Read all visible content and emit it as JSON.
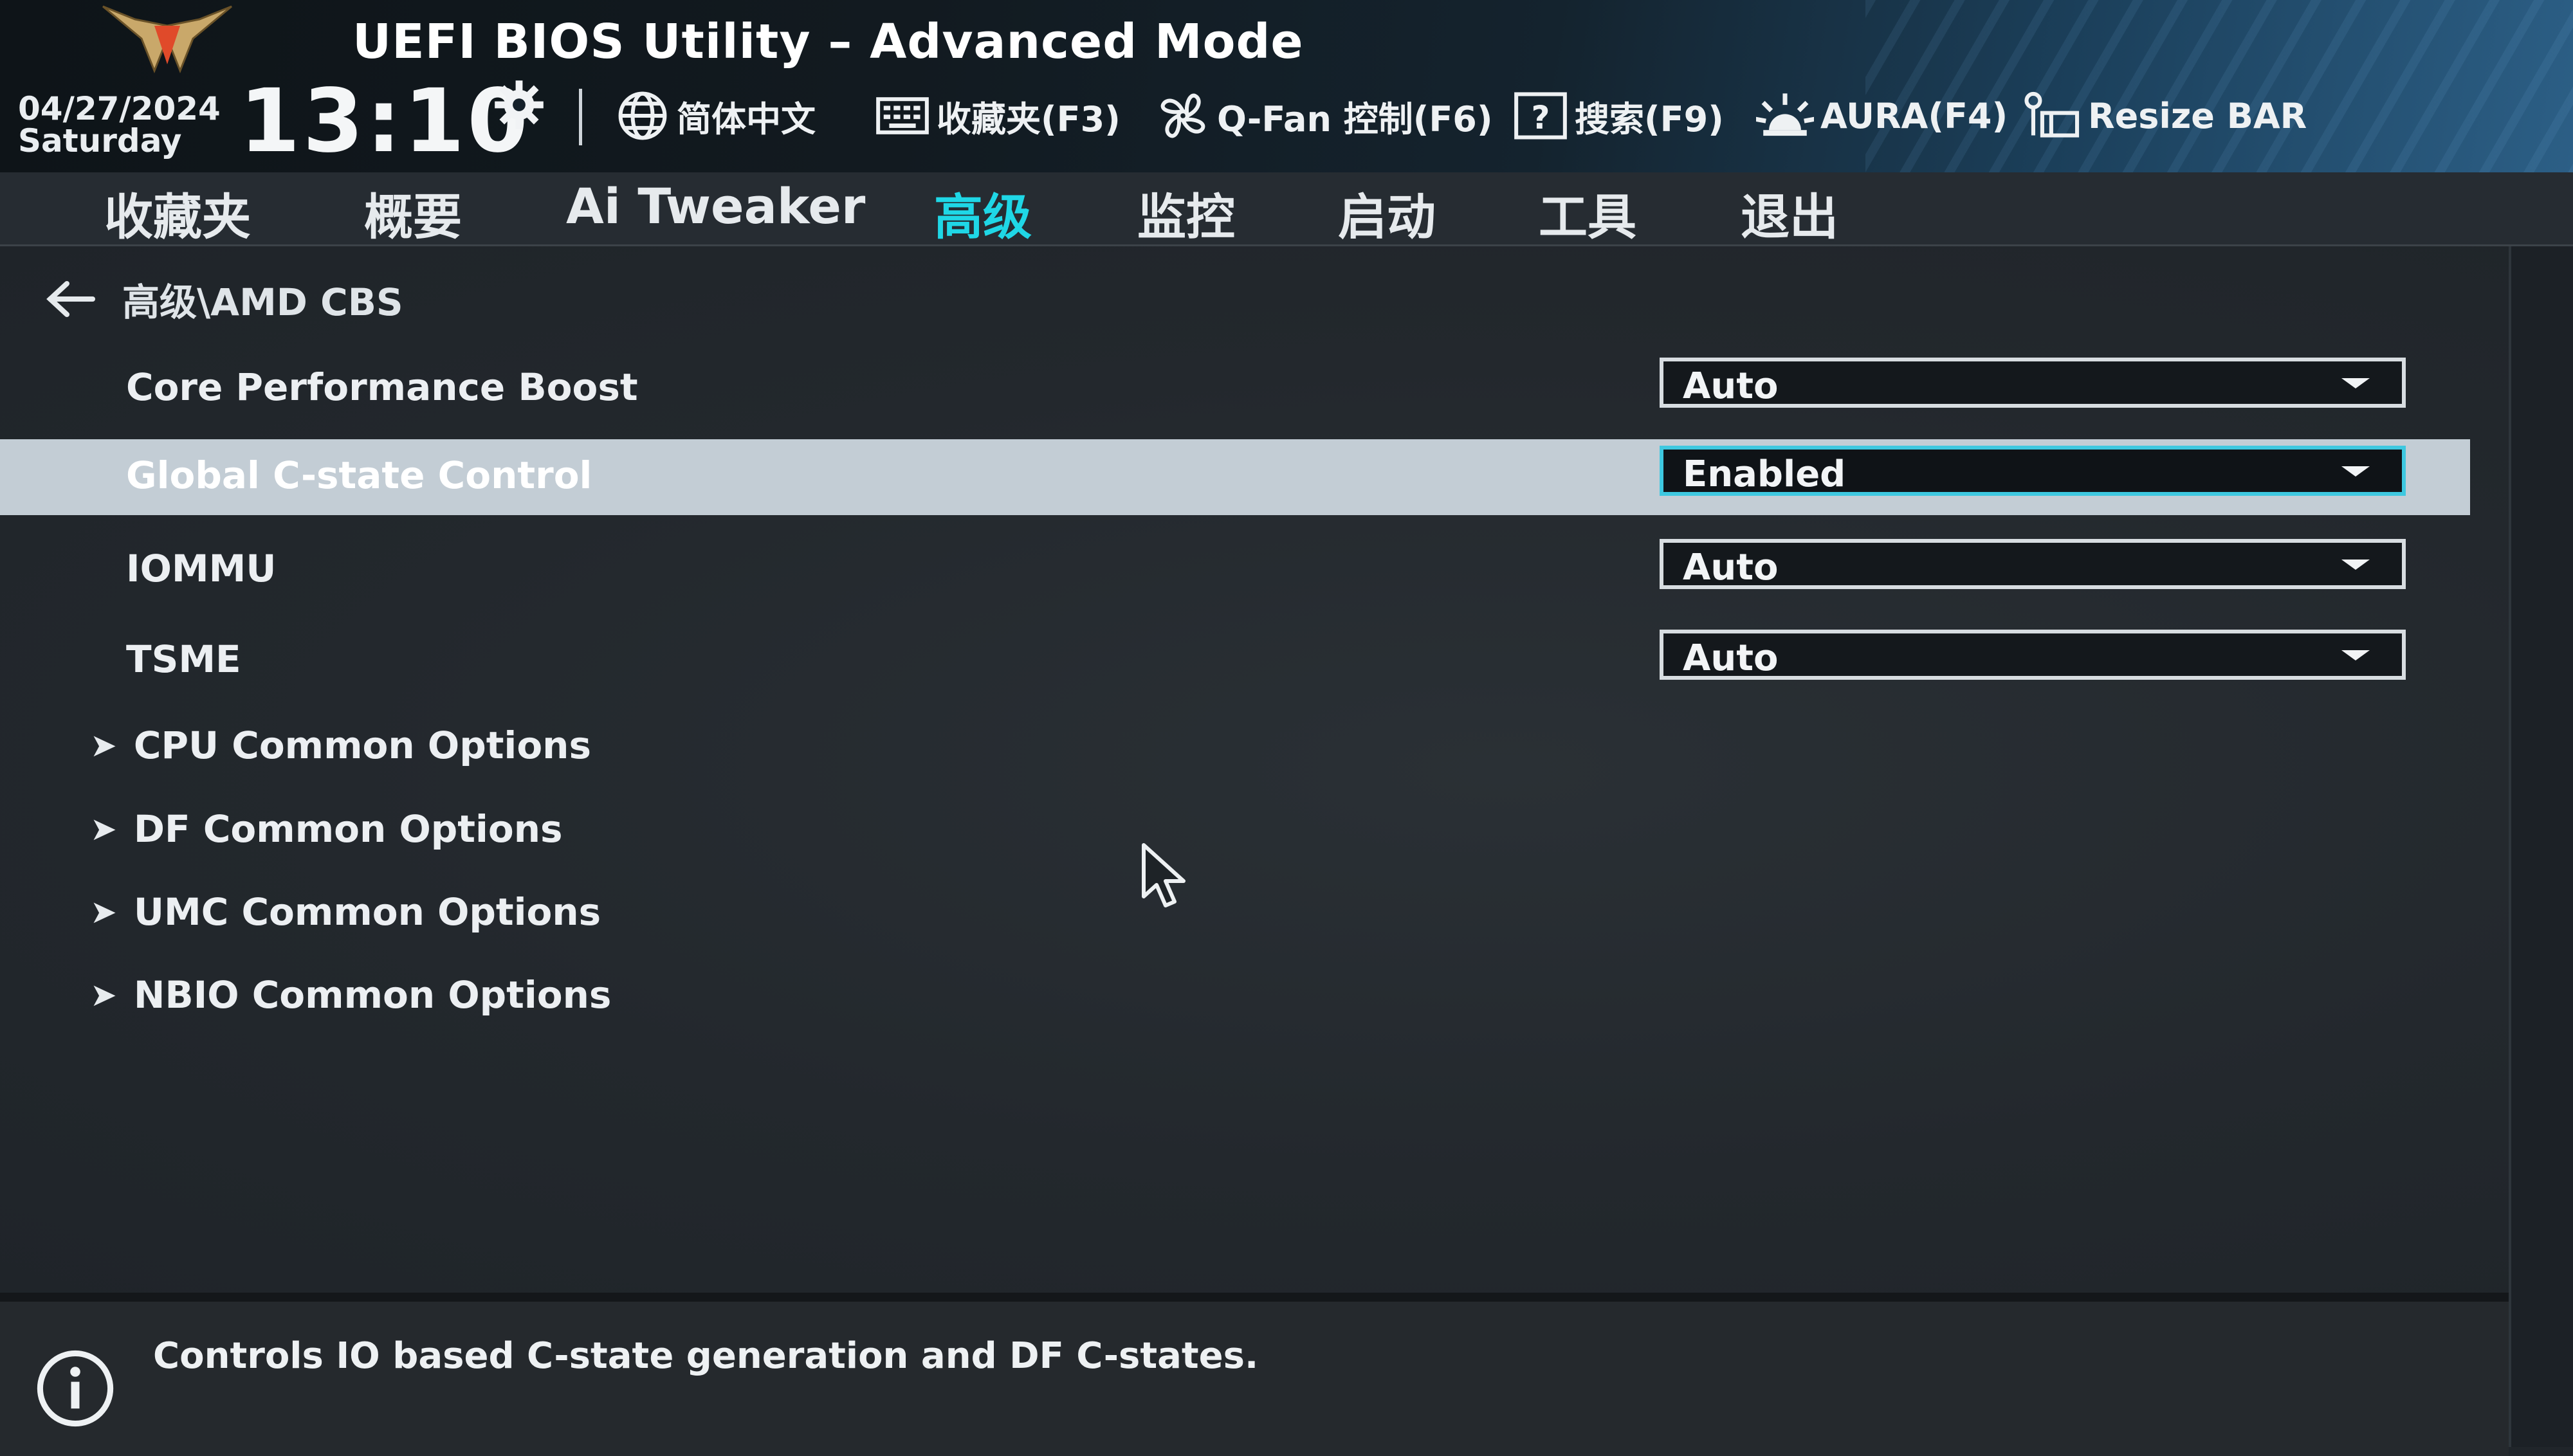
{
  "header": {
    "title": "UEFI BIOS Utility – Advanced Mode",
    "date": "04/27/2024",
    "weekday": "Saturday",
    "time": "13:10",
    "toolbar": [
      {
        "label": "简体中文",
        "icon": "globe-icon"
      },
      {
        "label": "收藏夹(F3)",
        "icon": "keyboard-icon"
      },
      {
        "label": "Q-Fan 控制(F6)",
        "icon": "fan-icon"
      },
      {
        "label": "搜索(F9)",
        "icon": "help-icon"
      },
      {
        "label": "AURA(F4)",
        "icon": "aura-icon"
      },
      {
        "label": "Resize BAR",
        "icon": "resize-bar-icon"
      }
    ]
  },
  "tabs": [
    {
      "label": "收藏夹"
    },
    {
      "label": "概要"
    },
    {
      "label": "Ai Tweaker"
    },
    {
      "label": "高级",
      "active": true
    },
    {
      "label": "监控"
    },
    {
      "label": "启动"
    },
    {
      "label": "工具"
    },
    {
      "label": "退出"
    }
  ],
  "breadcrumb": "高级\\AMD CBS",
  "settings": [
    {
      "label": "Core Performance Boost",
      "value": "Auto"
    },
    {
      "label": "Global C-state Control",
      "value": "Enabled",
      "selected": true
    },
    {
      "label": "IOMMU",
      "value": "Auto"
    },
    {
      "label": "TSME",
      "value": "Auto"
    }
  ],
  "submenus": [
    {
      "label": "CPU Common Options"
    },
    {
      "label": "DF Common Options"
    },
    {
      "label": "UMC Common Options"
    },
    {
      "label": "NBIO Common Options"
    }
  ],
  "help": {
    "text": "Controls IO based C-state generation and DF C-states."
  },
  "colors": {
    "accent": "#1fd7e6",
    "selected_row": "#c3cdd5",
    "background": "#20252a"
  }
}
